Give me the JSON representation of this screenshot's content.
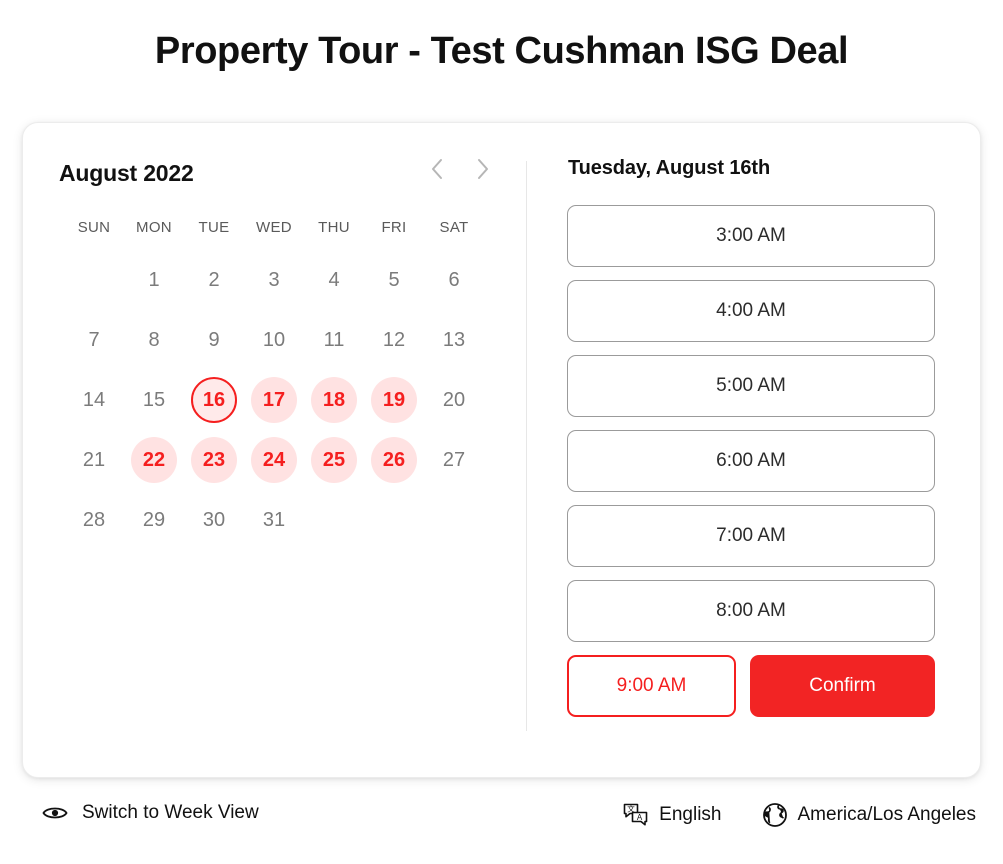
{
  "page": {
    "title": "Property Tour - Test Cushman ISG Deal",
    "accent_red": "#f51f1f",
    "confirm_red": "#f22424",
    "available_pink": "#ffe2e2",
    "muted_gray": "#7b7b7b"
  },
  "calendar": {
    "month_label": "August 2022",
    "prev_label": "Previous month",
    "next_label": "Next month",
    "weekdays": [
      "SUN",
      "MON",
      "TUE",
      "WED",
      "THU",
      "FRI",
      "SAT"
    ],
    "leading_blanks": 1,
    "days": [
      {
        "n": "1",
        "state": "default"
      },
      {
        "n": "2",
        "state": "default"
      },
      {
        "n": "3",
        "state": "default"
      },
      {
        "n": "4",
        "state": "default"
      },
      {
        "n": "5",
        "state": "default"
      },
      {
        "n": "6",
        "state": "default"
      },
      {
        "n": "7",
        "state": "default"
      },
      {
        "n": "8",
        "state": "default"
      },
      {
        "n": "9",
        "state": "default"
      },
      {
        "n": "10",
        "state": "default"
      },
      {
        "n": "11",
        "state": "default"
      },
      {
        "n": "12",
        "state": "default"
      },
      {
        "n": "13",
        "state": "default"
      },
      {
        "n": "14",
        "state": "default"
      },
      {
        "n": "15",
        "state": "default"
      },
      {
        "n": "16",
        "state": "selected"
      },
      {
        "n": "17",
        "state": "available"
      },
      {
        "n": "18",
        "state": "available"
      },
      {
        "n": "19",
        "state": "available"
      },
      {
        "n": "20",
        "state": "default"
      },
      {
        "n": "21",
        "state": "default"
      },
      {
        "n": "22",
        "state": "available"
      },
      {
        "n": "23",
        "state": "available"
      },
      {
        "n": "24",
        "state": "available"
      },
      {
        "n": "25",
        "state": "available"
      },
      {
        "n": "26",
        "state": "available"
      },
      {
        "n": "27",
        "state": "default"
      },
      {
        "n": "28",
        "state": "default"
      },
      {
        "n": "29",
        "state": "default"
      },
      {
        "n": "30",
        "state": "default"
      },
      {
        "n": "31",
        "state": "default"
      }
    ]
  },
  "slots": {
    "date_heading": "Tuesday, August 16th",
    "times": [
      {
        "label": "3:00 AM",
        "selected": false
      },
      {
        "label": "4:00 AM",
        "selected": false
      },
      {
        "label": "5:00 AM",
        "selected": false
      },
      {
        "label": "6:00 AM",
        "selected": false
      },
      {
        "label": "7:00 AM",
        "selected": false
      },
      {
        "label": "8:00 AM",
        "selected": false
      },
      {
        "label": "9:00 AM",
        "selected": true
      }
    ],
    "confirm_label": "Confirm"
  },
  "footer": {
    "week_view_label": "Switch to Week View",
    "language_label": "English",
    "timezone_label": "America/Los Angeles"
  }
}
